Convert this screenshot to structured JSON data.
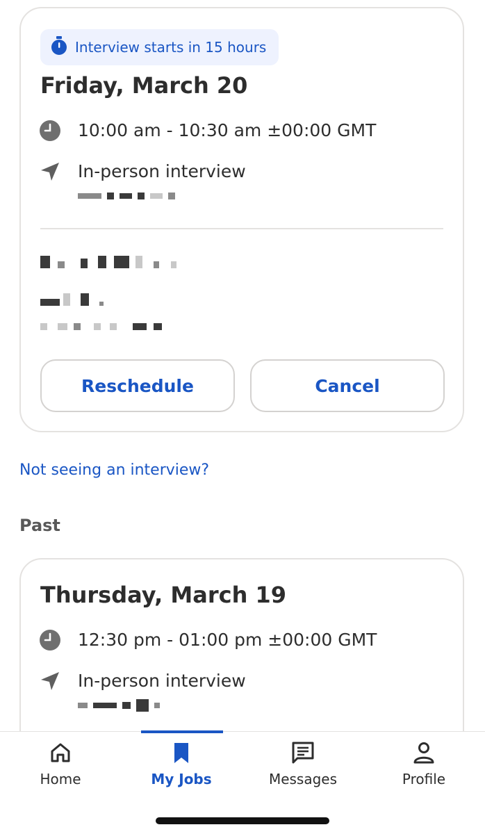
{
  "upcoming": {
    "badge": "Interview starts in 15 hours",
    "date": "Friday, March 20",
    "time": "10:00 am - 10:30 am ±00:00 GMT",
    "type": "In-person interview",
    "actions": {
      "reschedule": "Reschedule",
      "cancel": "Cancel"
    }
  },
  "help_link": "Not seeing an interview?",
  "past": {
    "section_title": "Past",
    "date": "Thursday, March 19",
    "time": "12:30 pm - 01:00 pm ±00:00 GMT",
    "type": "In-person interview"
  },
  "nav": {
    "items": [
      {
        "label": "Home",
        "icon": "home-icon"
      },
      {
        "label": "My Jobs",
        "icon": "bookmark-icon",
        "active": true
      },
      {
        "label": "Messages",
        "icon": "message-icon"
      },
      {
        "label": "Profile",
        "icon": "person-icon"
      }
    ]
  },
  "colors": {
    "accent": "#1a56c4",
    "text": "#2d2d2d",
    "badge_bg": "#eef2fe",
    "border": "#e4e2e0"
  }
}
